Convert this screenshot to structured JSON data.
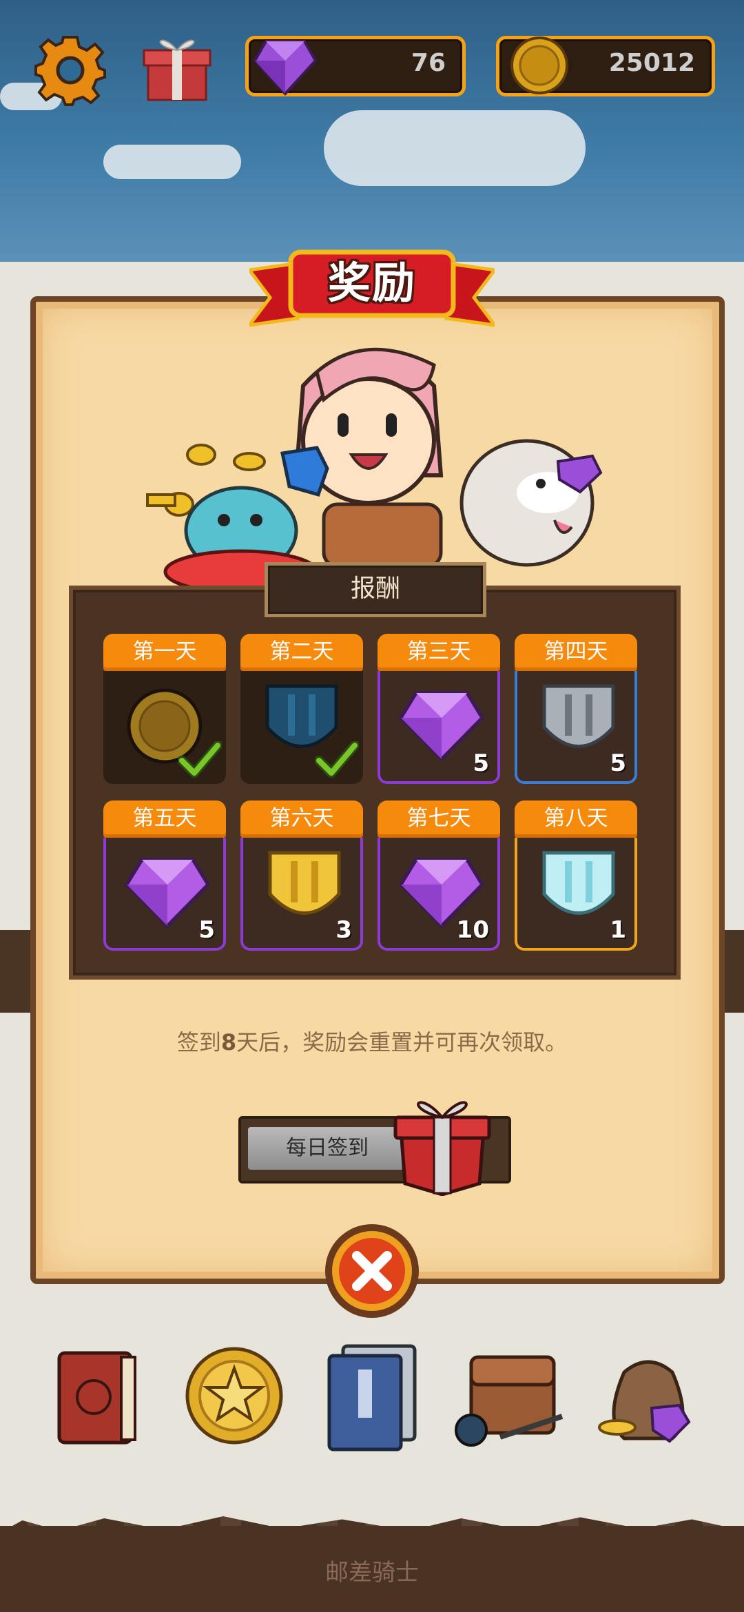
{
  "hud": {
    "gems": "76",
    "coins": "25012"
  },
  "dialog": {
    "title": "奖励",
    "rewards_header": "报酬",
    "days": [
      {
        "label": "第一天",
        "reward": "coin",
        "quantity": "",
        "claimed": true,
        "frame": "claimed"
      },
      {
        "label": "第二天",
        "reward": "blue-shield",
        "quantity": "",
        "claimed": true,
        "frame": "claimed"
      },
      {
        "label": "第三天",
        "reward": "purple-gem",
        "quantity": "5",
        "claimed": false,
        "frame": "purple"
      },
      {
        "label": "第四天",
        "reward": "silver-shield",
        "quantity": "5",
        "claimed": false,
        "frame": "blue"
      },
      {
        "label": "第五天",
        "reward": "purple-gem",
        "quantity": "5",
        "claimed": false,
        "frame": "purple"
      },
      {
        "label": "第六天",
        "reward": "gold-shield",
        "quantity": "3",
        "claimed": false,
        "frame": "purple"
      },
      {
        "label": "第七天",
        "reward": "purple-gem",
        "quantity": "10",
        "claimed": false,
        "frame": "purple"
      },
      {
        "label": "第八天",
        "reward": "ice-shield",
        "quantity": "1",
        "claimed": false,
        "frame": "gold"
      }
    ],
    "info_prefix": "签到",
    "info_number": "8",
    "info_suffix": "天后，奖励会重置并可再次领取。",
    "checkin_label": "每日签到"
  },
  "footer": {
    "app_name": "邮差骑士"
  },
  "colors": {
    "accent_orange": "#f58a0c",
    "frame_purple": "#8d3ad6",
    "frame_blue": "#3c7cd3",
    "frame_gold": "#f1a518",
    "check_green": "#7ac62a",
    "close_red": "#e0431a"
  }
}
